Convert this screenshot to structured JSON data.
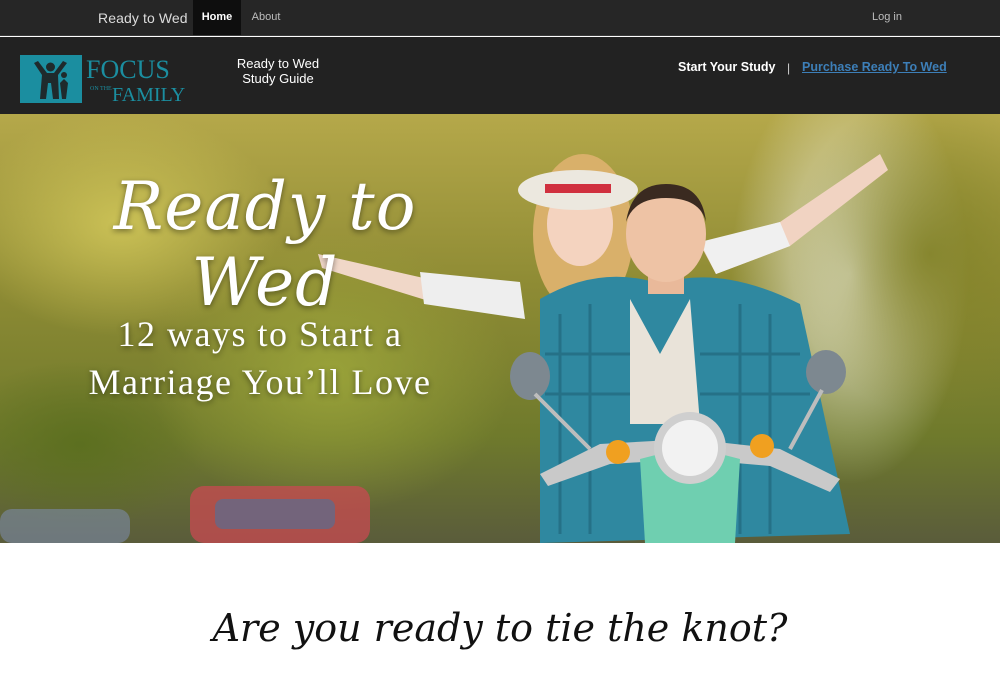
{
  "topnav": {
    "brand": "Ready to Wed",
    "items": [
      {
        "label": "Home",
        "active": true
      },
      {
        "label": "About",
        "active": false
      }
    ],
    "login": "Log in"
  },
  "header": {
    "logo_text": "FOCUS",
    "logo_on_the": "ON THE",
    "logo_family": "FAMILY",
    "guide_title_line1": "Ready to Wed",
    "guide_title_line2": "Study Guide",
    "start_link": "Start Your Study",
    "separator": "|",
    "purchase_link": "Purchase Ready To Wed"
  },
  "hero": {
    "title": "Ready to Wed",
    "subtitle_line1": "12 ways to Start a",
    "subtitle_line2": "Marriage You’ll Love"
  },
  "tagline": "Are you ready to tie the knot?",
  "colors": {
    "nav_bg": "#262626",
    "header_bg": "#222222",
    "logo_teal": "#1b8ea0",
    "link_blue": "#3d7fb8"
  }
}
